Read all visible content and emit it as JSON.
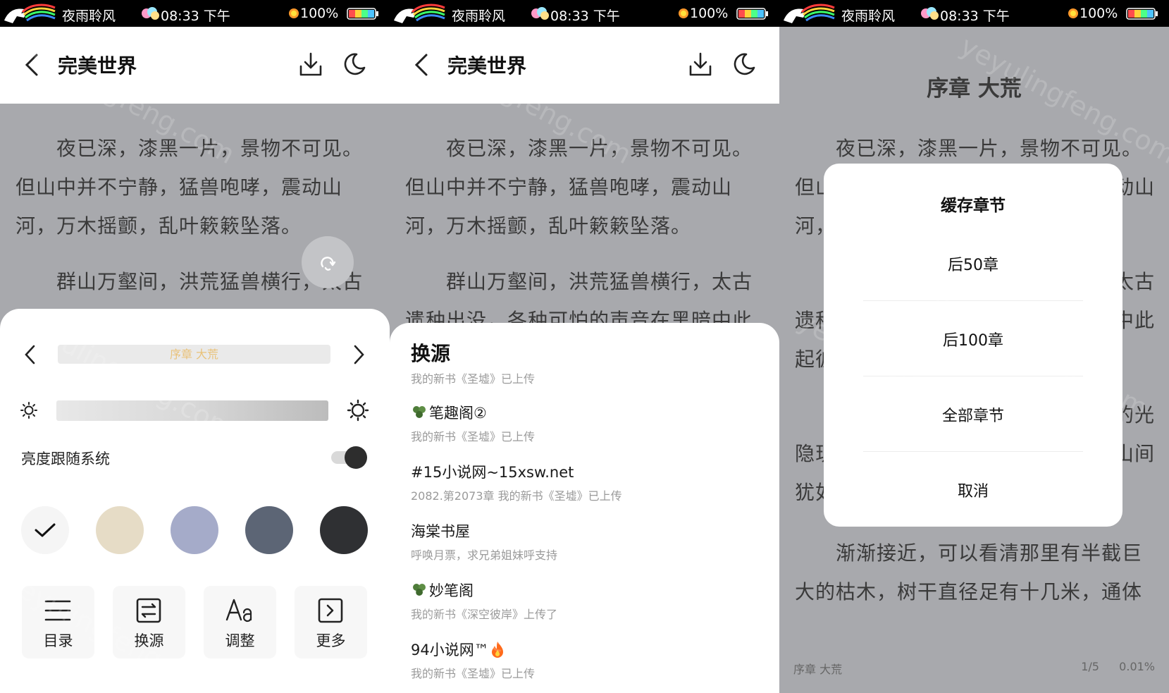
{
  "statusbar": {
    "app": "夜雨聆风",
    "time": "08:33 下午",
    "battery": "100%"
  },
  "toolbar": {
    "title": "完美世界"
  },
  "reader": {
    "para1": "夜已深，漆黑一片，景物不可见。但山中并不宁静，猛兽咆哮，震动山河，万木摇颤，乱叶簌簌坠落。",
    "para2": "群山万壑间，洪荒猛兽横行，太古遗种出没，各种可怕的声音在黑暗中此起彼伏",
    "para2_cut": "遗种出没，各种可怕的声音在黑暗中此",
    "s3_p2a": "遗种",
    "s3_p2b": "中此",
    "s3_p2c": "起彼",
    "s3_p3a": "的光",
    "s3_p3b": "隐现",
    "s3_p3c": "山间",
    "s3_p3d": "犹如",
    "s3_p1b_left": "但山",
    "s3_p1b_right": "动山",
    "s3_p1c_left": "河，",
    "s3_p2_right": "太古",
    "para4": "渐渐接近，可以看清那里有半截巨大的枯木，树干直径足有十几米，通体"
  },
  "settings": {
    "chapter": "序章 大荒",
    "follow_system": "亮度跟随系统",
    "follow_system_on": true,
    "themes": [
      "#f5f5f5",
      "#e6dcc6",
      "#a5abc9",
      "#5c6575",
      "#2f3033"
    ],
    "menu": [
      {
        "label": "目录",
        "icon": "list-icon"
      },
      {
        "label": "换源",
        "icon": "switch-source-icon"
      },
      {
        "label": "调整",
        "icon": "font-icon"
      },
      {
        "label": "更多",
        "icon": "more-icon"
      }
    ]
  },
  "source": {
    "title": "换源",
    "subtitle": "我的新书《圣墟》已上传",
    "items": [
      {
        "name": "笔趣阁②",
        "leaf": true,
        "fire": false,
        "desc": "我的新书《圣墟》已上传"
      },
      {
        "name": "#15小说网~15xsw.net",
        "leaf": false,
        "fire": false,
        "desc": "2082.第2073章 我的新书《圣墟》已上传"
      },
      {
        "name": "海棠书屋",
        "leaf": false,
        "fire": false,
        "desc": "呼唤月票，求兄弟姐妹呼支持"
      },
      {
        "name": "妙笔阁",
        "leaf": true,
        "fire": false,
        "desc": "我的新书《深空彼岸》上传了"
      },
      {
        "name": "94小说网™",
        "leaf": false,
        "fire": true,
        "desc": "我的新书《圣墟》已上传"
      }
    ]
  },
  "cache_dialog": {
    "title": "缓存章节",
    "opt1": "后50章",
    "opt2": "后100章",
    "opt3": "全部章节",
    "cancel": "取消"
  },
  "footer": {
    "chapter": "序章 大荒",
    "page": "1/5",
    "percent": "0.01%"
  },
  "watermark": "yeyulingfeng.com"
}
